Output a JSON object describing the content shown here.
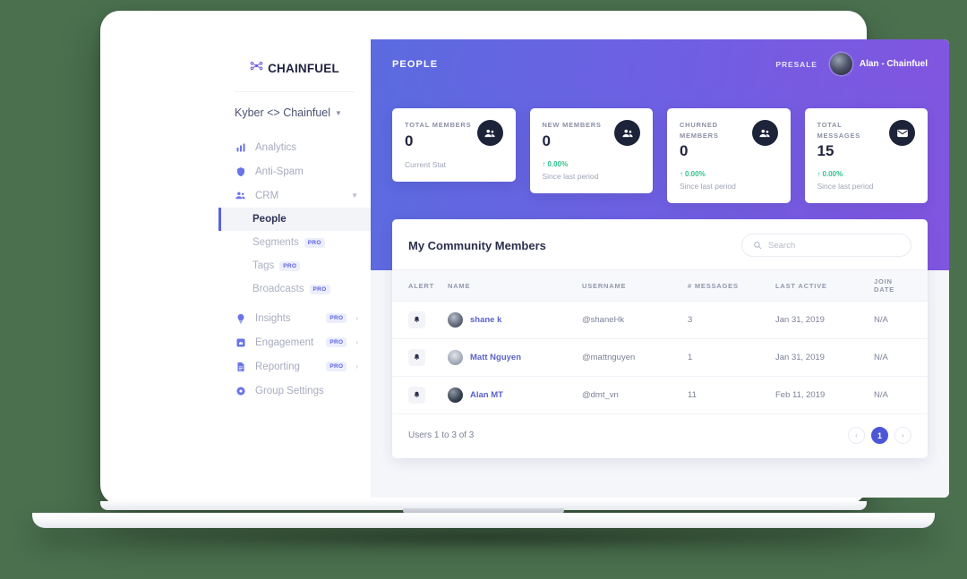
{
  "brand": {
    "wordmark": "CHAINFUEL",
    "logo_icon": "molecule-icon"
  },
  "sidebar": {
    "workspace": {
      "label": "Kyber <> Chainfuel",
      "caret_icon": "chevron-down-icon"
    },
    "items": [
      {
        "label": "Analytics",
        "icon": "bar-chart-icon"
      },
      {
        "label": "Anti-Spam",
        "icon": "shield-icon"
      },
      {
        "label": "CRM",
        "icon": "users-icon",
        "chevron": "chevron-down-icon"
      }
    ],
    "sub_items": [
      {
        "label": "People",
        "active": true,
        "badge": ""
      },
      {
        "label": "Segments",
        "active": false,
        "badge": "PRO"
      },
      {
        "label": "Tags",
        "active": false,
        "badge": "PRO"
      },
      {
        "label": "Broadcasts",
        "active": false,
        "badge": "PRO"
      }
    ],
    "items_lower": [
      {
        "label": "Insights",
        "icon": "lightbulb-icon",
        "badge": "PRO",
        "chevron": "chevron-right-icon"
      },
      {
        "label": "Engagement",
        "icon": "megaphone-icon",
        "badge": "PRO",
        "chevron": "chevron-right-icon"
      },
      {
        "label": "Reporting",
        "icon": "document-icon",
        "badge": "PRO",
        "chevron": "chevron-right-icon"
      },
      {
        "label": "Group Settings",
        "icon": "gear-icon",
        "badge": "",
        "chevron": ""
      }
    ]
  },
  "topbar": {
    "page_title": "PEOPLE",
    "plan_badge": "PRESALE",
    "user_name": "Alan - Chainfuel",
    "avatar_icon": "user-avatar"
  },
  "stats": [
    {
      "label": "TOTAL MEMBERS",
      "value": "0",
      "icon": "users-icon",
      "delta": "",
      "sub": "Current Stat"
    },
    {
      "label": "NEW MEMBERS",
      "value": "0",
      "icon": "users-icon",
      "delta": "0.00%",
      "sub": "Since last period"
    },
    {
      "label": "CHURNED MEMBERS",
      "value": "0",
      "icon": "users-icon",
      "delta": "0.00%",
      "sub": "Since last period"
    },
    {
      "label": "TOTAL MESSAGES",
      "value": "15",
      "icon": "envelope-icon",
      "delta": "0.00%",
      "sub": "Since last period"
    }
  ],
  "table": {
    "title": "My Community Members",
    "search": {
      "placeholder": "Search",
      "value": "",
      "icon": "search-icon"
    },
    "columns": [
      "ALERT",
      "NAME",
      "USERNAME",
      "# MESSAGES",
      "LAST ACTIVE",
      "JOIN DATE"
    ],
    "rows": [
      {
        "alert_icon": "bell-icon",
        "name": "shane k",
        "username": "@shaneHk",
        "messages": "3",
        "last_active": "Jan 31, 2019",
        "join_date": "N/A"
      },
      {
        "alert_icon": "bell-icon",
        "name": "Matt Nguyen",
        "username": "@mattnguyen",
        "messages": "1",
        "last_active": "Jan 31, 2019",
        "join_date": "N/A"
      },
      {
        "alert_icon": "bell-icon",
        "name": "Alan MT",
        "username": "@dmt_vn",
        "messages": "11",
        "last_active": "Feb 11, 2019",
        "join_date": "N/A"
      }
    ],
    "footer": {
      "summary": "Users 1 to 3 of 3",
      "prev_icon": "chevron-left-icon",
      "next_icon": "chevron-right-icon",
      "current_page": "1"
    }
  },
  "colors": {
    "accent": "#5a62e0",
    "gradient_start": "#5b6be0",
    "gradient_end": "#8155e0",
    "positive": "#2fc28a",
    "backdrop": "#4a704e",
    "stat_icon_bg": "#1d2338"
  }
}
